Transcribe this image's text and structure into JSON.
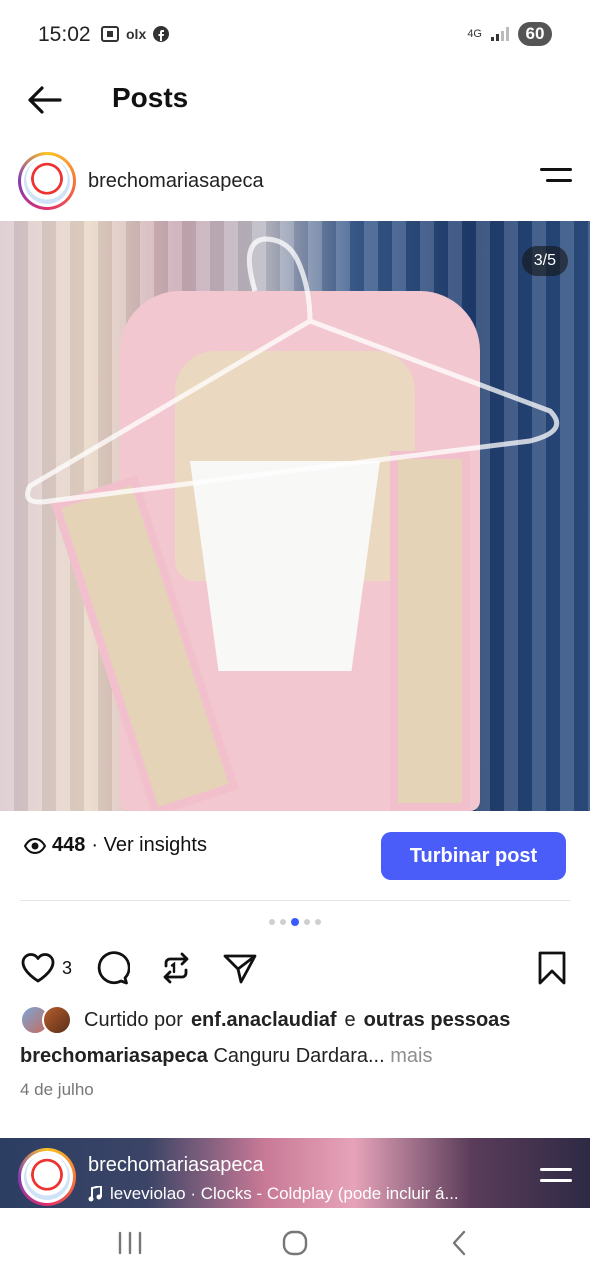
{
  "status_bar": {
    "time": "15:02",
    "app_icons": [
      "screenshot-icon",
      "olx-icon",
      "facebook-icon"
    ],
    "olx_text": "olx",
    "network": "4G",
    "battery": "60"
  },
  "header": {
    "title": "Posts"
  },
  "post": {
    "author": "brechomariasapeca",
    "image_counter": "3/5",
    "views": "448",
    "insights_label": "· Ver insights",
    "boost_button": "Turbinar post",
    "carousel": {
      "total": 5,
      "active": 3
    },
    "like_count": "3",
    "liked_prefix": "Curtido por",
    "liked_user": "enf.anaclaudiaf",
    "liked_and": "e",
    "liked_others": "outras pessoas",
    "caption_author": "brechomariasapeca",
    "caption_text": "Canguru Dardara...",
    "caption_more": "mais",
    "date": "4 de julho"
  },
  "next_post": {
    "author": "brechomariasapeca",
    "music": "leveviolao · Clocks - Coldplay (pode incluir á..."
  },
  "colors": {
    "accent": "#4a5df9",
    "active_dot": "#3b5bfd"
  }
}
